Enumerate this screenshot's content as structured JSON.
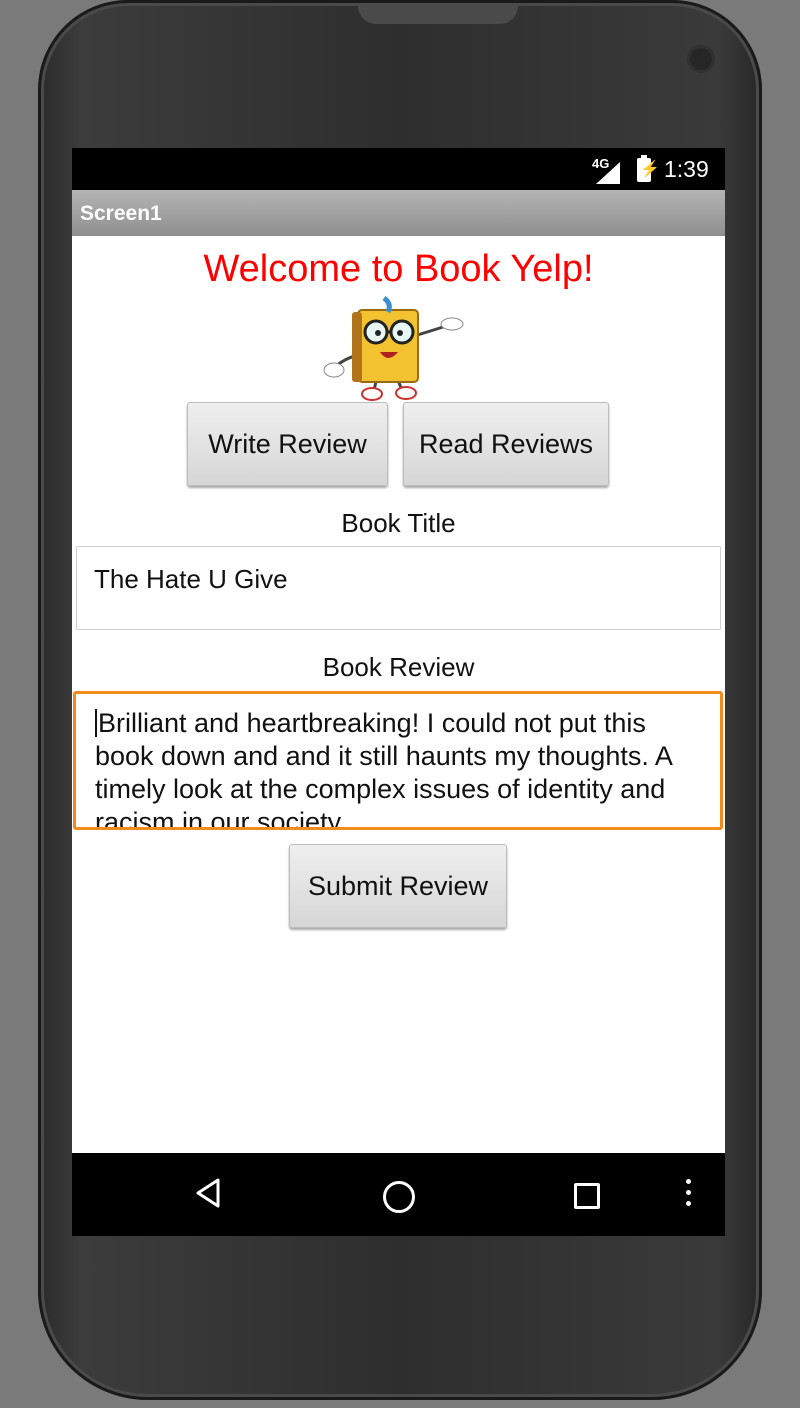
{
  "status_bar": {
    "network": "4G",
    "time": "1:39"
  },
  "app": {
    "title": "Screen1"
  },
  "main": {
    "welcome": "Welcome  to Book  Yelp!",
    "write_button": "Write  Review",
    "read_button": "Read Reviews",
    "book_title_label": "Book Title",
    "book_title_value": "The Hate U Give",
    "book_review_label": "Book  Review",
    "book_review_value": "Brilliant and heartbreaking!  I could not put this book down and and it still haunts my thoughts.  A timely look at the complex issues of identity and racism in our society.",
    "submit_button": "Submit Review",
    "review_field_border_color": "#f38b1c",
    "welcome_color": "#ff0000"
  },
  "nav": {
    "icons": [
      "back-icon",
      "home-icon",
      "recent-apps-icon",
      "overflow-menu-icon"
    ]
  }
}
